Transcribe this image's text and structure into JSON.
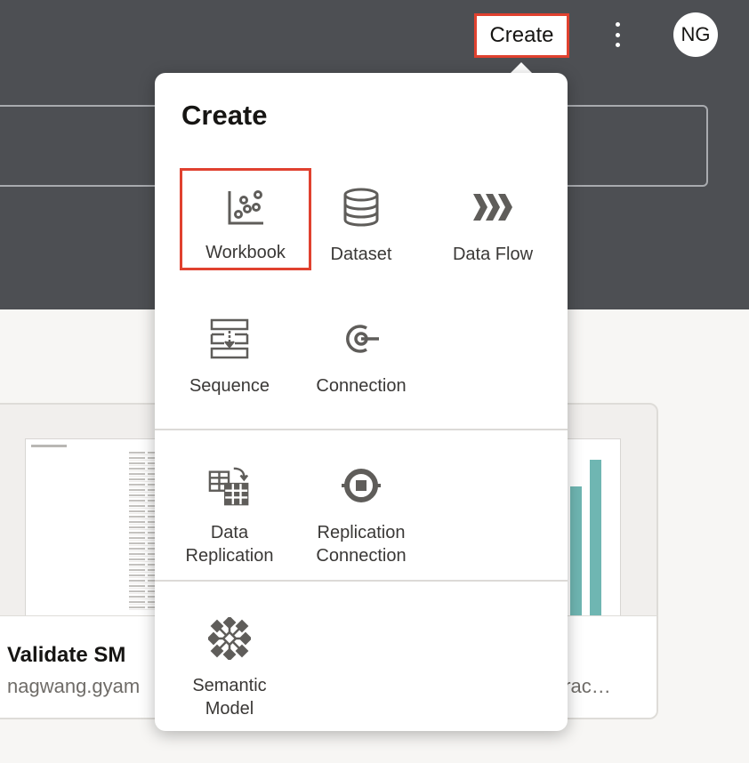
{
  "header": {
    "create_label": "Create",
    "avatar_initials": "NG",
    "kebab_icon": "more-vertical-icon"
  },
  "search": {
    "placeholder": ""
  },
  "cards": [
    {
      "title": "Validate SM",
      "subtitle": "nagwang.gyam"
    },
    {
      "subtitle": "orac…"
    }
  ],
  "create_menu": {
    "title": "Create",
    "sections": [
      {
        "items": [
          {
            "label": "Workbook",
            "icon": "workbook-scatter-icon",
            "selected": true
          },
          {
            "label": "Dataset",
            "icon": "database-icon"
          },
          {
            "label": "Data Flow",
            "icon": "chevrons-right-icon"
          },
          {
            "label": "Sequence",
            "icon": "sequence-icon"
          },
          {
            "label": "Connection",
            "icon": "connection-icon"
          }
        ]
      },
      {
        "items": [
          {
            "label": "Data\nReplication",
            "icon": "data-replication-icon"
          },
          {
            "label": "Replication\nConnection",
            "icon": "replication-connection-icon"
          }
        ]
      },
      {
        "items": [
          {
            "label": "Semantic\nModel",
            "icon": "semantic-model-icon"
          }
        ]
      }
    ]
  },
  "colors": {
    "header_bg": "#4d4f53",
    "highlight": "#e0412f",
    "icon": "#5f5d5a",
    "bar": "#6fb6b2"
  }
}
